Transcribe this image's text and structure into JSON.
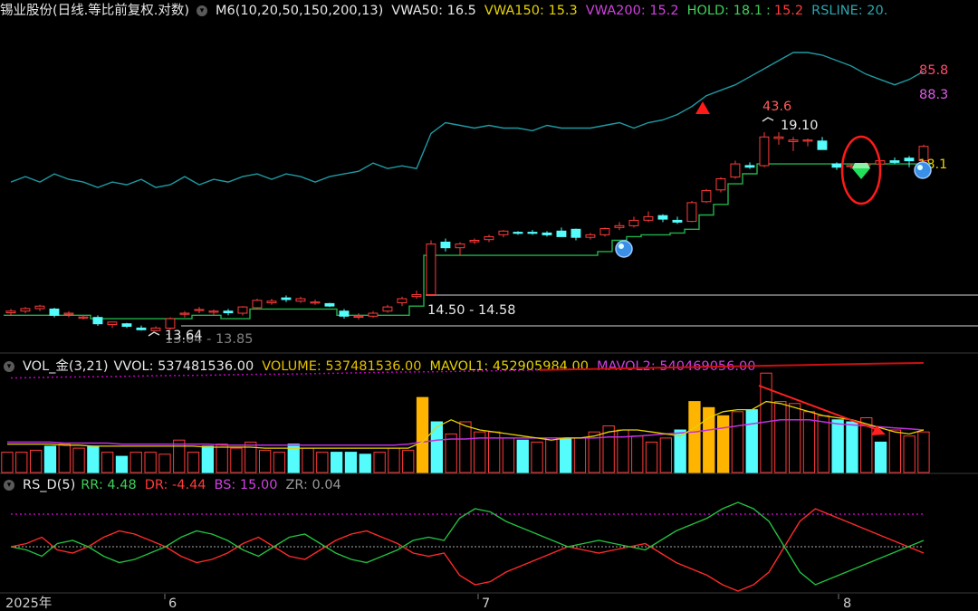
{
  "main": {
    "title": "锡业股份(日线.等比前复权.对数)",
    "indicator_name": "M6(10,20,50,150,200,13)",
    "vwa50": "VWA50: 16.5",
    "vwa150": "VWA150: 15.3",
    "vwa200": "VWA200: 15.2",
    "hold": "HOLD: 18.1",
    "hold_sep": ":",
    "hold_val2": "15.2",
    "rsline": "RSLINE: 20.",
    "label_rs_high": "85.8",
    "label_rs_now": "88.3",
    "label_peak": "43.6",
    "label_high_price": "19.10",
    "label_hold": "18.1",
    "label_range": "14.50 - 14.58",
    "label_low": "13.64",
    "label_low_range": "13.64 - 13.85"
  },
  "vol": {
    "name": "VOL_金(3,21)",
    "vvol": "VVOL: 537481536.00",
    "volume": "VOLUME: 537481536.00",
    "mavol1": "MAVOL1: 452905984.00",
    "mavol2": "MAVOL2: 540469056.00"
  },
  "rsd": {
    "name": "RS_D(5)",
    "rr": "RR: 4.48",
    "dr": "DR: -4.44",
    "bs": "BS: 15.00",
    "zr": "ZR: 0.04"
  },
  "xaxis": {
    "year": "2025年",
    "m6": "6",
    "m7": "7",
    "m8": "8"
  },
  "colors": {
    "up": "#ff3b3b",
    "down": "#54fcfc",
    "hold_line": "#21b14a",
    "rsline": "#1f9aa3",
    "vwa_purple": "#c000c0",
    "vwa_red": "#cc1010",
    "vol_gold": "#ffb400",
    "mavol1": "#e6d200",
    "mavol2": "#c030e0"
  },
  "chart_data": [
    {
      "type": "candlestick",
      "title": "锡业股份(日线.等比前复权.对数)",
      "scale": "log",
      "candles": [
        {
          "o": 14.06,
          "h": 14.15,
          "l": 14.0,
          "c": 14.1
        },
        {
          "o": 14.1,
          "h": 14.2,
          "l": 14.05,
          "c": 14.16
        },
        {
          "o": 14.16,
          "h": 14.25,
          "l": 14.1,
          "c": 14.22
        },
        {
          "o": 14.15,
          "h": 14.18,
          "l": 13.95,
          "c": 14.0
        },
        {
          "o": 14.05,
          "h": 14.1,
          "l": 13.95,
          "c": 14.05
        },
        {
          "o": 13.96,
          "h": 14.0,
          "l": 13.9,
          "c": 13.96
        },
        {
          "o": 13.95,
          "h": 14.0,
          "l": 13.75,
          "c": 13.8
        },
        {
          "o": 13.78,
          "h": 13.85,
          "l": 13.7,
          "c": 13.84
        },
        {
          "o": 13.8,
          "h": 13.82,
          "l": 13.7,
          "c": 13.74
        },
        {
          "o": 13.7,
          "h": 13.76,
          "l": 13.64,
          "c": 13.66
        },
        {
          "o": 13.64,
          "h": 13.74,
          "l": 13.62,
          "c": 13.7
        },
        {
          "o": 13.7,
          "h": 13.95,
          "l": 13.66,
          "c": 13.92
        },
        {
          "o": 14.05,
          "h": 14.1,
          "l": 13.95,
          "c": 14.05
        },
        {
          "o": 14.12,
          "h": 14.2,
          "l": 14.05,
          "c": 14.14
        },
        {
          "o": 14.1,
          "h": 14.14,
          "l": 14.0,
          "c": 14.1
        },
        {
          "o": 14.1,
          "h": 14.15,
          "l": 14.0,
          "c": 14.06
        },
        {
          "o": 14.05,
          "h": 14.22,
          "l": 14.0,
          "c": 14.2
        },
        {
          "o": 14.18,
          "h": 14.4,
          "l": 14.15,
          "c": 14.36
        },
        {
          "o": 14.3,
          "h": 14.4,
          "l": 14.25,
          "c": 14.34
        },
        {
          "o": 14.42,
          "h": 14.48,
          "l": 14.32,
          "c": 14.38
        },
        {
          "o": 14.34,
          "h": 14.45,
          "l": 14.3,
          "c": 14.4
        },
        {
          "o": 14.32,
          "h": 14.38,
          "l": 14.25,
          "c": 14.32
        },
        {
          "o": 14.28,
          "h": 14.3,
          "l": 14.2,
          "c": 14.22
        },
        {
          "o": 14.1,
          "h": 14.15,
          "l": 13.92,
          "c": 13.98
        },
        {
          "o": 13.98,
          "h": 14.05,
          "l": 13.9,
          "c": 13.98
        },
        {
          "o": 13.98,
          "h": 14.1,
          "l": 13.94,
          "c": 14.05
        },
        {
          "o": 14.1,
          "h": 14.25,
          "l": 14.06,
          "c": 14.2
        },
        {
          "o": 14.3,
          "h": 14.45,
          "l": 14.22,
          "c": 14.4
        },
        {
          "o": 14.45,
          "h": 14.6,
          "l": 14.4,
          "c": 14.5
        },
        {
          "o": 14.5,
          "h": 15.9,
          "l": 14.5,
          "c": 15.8
        },
        {
          "o": 15.85,
          "h": 15.95,
          "l": 15.6,
          "c": 15.7
        },
        {
          "o": 15.7,
          "h": 15.85,
          "l": 15.5,
          "c": 15.8
        },
        {
          "o": 15.86,
          "h": 15.95,
          "l": 15.8,
          "c": 15.9
        },
        {
          "o": 15.92,
          "h": 16.05,
          "l": 15.85,
          "c": 16.0
        },
        {
          "o": 16.05,
          "h": 16.18,
          "l": 15.98,
          "c": 16.15
        },
        {
          "o": 16.12,
          "h": 16.15,
          "l": 16.05,
          "c": 16.1
        },
        {
          "o": 16.12,
          "h": 16.18,
          "l": 16.05,
          "c": 16.1
        },
        {
          "o": 16.1,
          "h": 16.15,
          "l": 16.0,
          "c": 16.05
        },
        {
          "o": 16.15,
          "h": 16.25,
          "l": 16.0,
          "c": 16.0
        },
        {
          "o": 16.2,
          "h": 16.22,
          "l": 15.9,
          "c": 15.98
        },
        {
          "o": 15.98,
          "h": 16.1,
          "l": 15.92,
          "c": 16.05
        },
        {
          "o": 16.05,
          "h": 16.25,
          "l": 16.0,
          "c": 16.22
        },
        {
          "o": 16.25,
          "h": 16.4,
          "l": 16.18,
          "c": 16.3
        },
        {
          "o": 16.3,
          "h": 16.55,
          "l": 16.25,
          "c": 16.45
        },
        {
          "o": 16.45,
          "h": 16.7,
          "l": 16.4,
          "c": 16.55
        },
        {
          "o": 16.58,
          "h": 16.62,
          "l": 16.4,
          "c": 16.48
        },
        {
          "o": 16.45,
          "h": 16.55,
          "l": 16.35,
          "c": 16.4
        },
        {
          "o": 16.42,
          "h": 17.0,
          "l": 16.4,
          "c": 16.95
        },
        {
          "o": 16.98,
          "h": 17.35,
          "l": 16.95,
          "c": 17.3
        },
        {
          "o": 17.32,
          "h": 17.7,
          "l": 17.25,
          "c": 17.65
        },
        {
          "o": 17.7,
          "h": 18.2,
          "l": 17.65,
          "c": 18.1
        },
        {
          "o": 18.05,
          "h": 18.15,
          "l": 17.95,
          "c": 18.0
        },
        {
          "o": 18.05,
          "h": 19.1,
          "l": 18.0,
          "c": 18.95
        },
        {
          "o": 18.9,
          "h": 19.1,
          "l": 18.7,
          "c": 18.95
        },
        {
          "o": 18.8,
          "h": 18.95,
          "l": 18.5,
          "c": 18.85
        },
        {
          "o": 18.82,
          "h": 18.9,
          "l": 18.65,
          "c": 18.85
        },
        {
          "o": 18.82,
          "h": 18.95,
          "l": 18.6,
          "c": 18.55
        },
        {
          "o": 18.1,
          "h": 18.15,
          "l": 17.92,
          "c": 18.0
        },
        {
          "o": 18.05,
          "h": 18.1,
          "l": 17.95,
          "c": 18.05
        },
        {
          "o": 18.05,
          "h": 18.15,
          "l": 17.98,
          "c": 18.1
        },
        {
          "o": 18.1,
          "h": 18.2,
          "l": 18.0,
          "c": 18.2
        },
        {
          "o": 18.2,
          "h": 18.3,
          "l": 18.1,
          "c": 18.15
        },
        {
          "o": 18.28,
          "h": 18.35,
          "l": 18.0,
          "c": 18.2
        },
        {
          "o": 18.2,
          "h": 18.7,
          "l": 18.15,
          "c": 18.65
        }
      ],
      "hold_line": [
        14.0,
        14.0,
        14.0,
        14.0,
        14.0,
        14.0,
        13.92,
        13.92,
        13.92,
        13.92,
        13.92,
        13.92,
        13.92,
        14.0,
        14.0,
        13.92,
        13.92,
        14.15,
        14.15,
        14.15,
        14.15,
        14.15,
        14.15,
        14.0,
        14.0,
        14.0,
        14.0,
        14.0,
        14.22,
        15.5,
        15.5,
        15.5,
        15.5,
        15.5,
        15.5,
        15.5,
        15.5,
        15.5,
        15.5,
        15.5,
        15.5,
        15.6,
        15.9,
        16.0,
        16.05,
        16.05,
        16.1,
        16.2,
        16.6,
        16.9,
        17.5,
        17.8,
        18.1,
        18.1,
        18.1,
        18.1,
        18.1,
        18.1,
        18.1,
        18.1,
        18.1,
        18.1,
        18.1,
        18.1
      ],
      "rsline": [
        82.0,
        82.2,
        82.0,
        82.3,
        82.1,
        82.0,
        81.8,
        82.0,
        81.9,
        82.1,
        81.8,
        81.9,
        82.2,
        81.9,
        82.1,
        82.0,
        82.2,
        82.3,
        82.1,
        82.3,
        82.2,
        82.0,
        82.2,
        82.3,
        82.4,
        82.7,
        82.5,
        82.6,
        82.5,
        83.8,
        84.2,
        84.1,
        84.0,
        84.1,
        84.0,
        84.0,
        83.9,
        84.1,
        84.0,
        84.0,
        84.0,
        84.1,
        84.2,
        84.0,
        84.2,
        84.3,
        84.5,
        84.8,
        85.2,
        85.4,
        85.6,
        85.9,
        86.2,
        86.5,
        86.8,
        86.8,
        86.7,
        86.5,
        86.3,
        86.0,
        85.8,
        85.6,
        85.8,
        86.1
      ],
      "vwa_dotted": [
        13.08,
        13.1,
        13.11,
        13.13,
        13.14,
        13.16,
        13.17,
        13.19,
        13.21,
        13.22,
        13.24,
        13.26,
        13.28,
        13.3,
        13.32,
        13.34,
        13.36,
        13.38,
        13.4,
        13.42
      ],
      "vwa150": 15.3,
      "vwa200": 15.2,
      "annotations": [
        "43.6",
        "19.10",
        "18.1",
        "14.50 - 14.58",
        "13.64",
        "13.64 - 13.85",
        "85.8",
        "88.3"
      ]
    },
    {
      "type": "bar",
      "title": "VOL_金(3,21)",
      "values": [
        20,
        20,
        22,
        26,
        28,
        24,
        26,
        20,
        16,
        20,
        20,
        18,
        32,
        20,
        26,
        28,
        24,
        30,
        22,
        20,
        28,
        24,
        20,
        20,
        20,
        18,
        20,
        24,
        22,
        74,
        50,
        38,
        50,
        40,
        40,
        34,
        32,
        30,
        34,
        34,
        34,
        40,
        46,
        42,
        36,
        30,
        34,
        42,
        70,
        64,
        56,
        60,
        62,
        98,
        70,
        68,
        60,
        56,
        52,
        50,
        54,
        30,
        42,
        36,
        40
      ],
      "colors": [
        "up",
        "up",
        "up",
        "down",
        "up",
        "up",
        "down",
        "up",
        "down",
        "up",
        "up",
        "up",
        "up",
        "up",
        "down",
        "up",
        "up",
        "up",
        "up",
        "up",
        "down",
        "up",
        "up",
        "down",
        "down",
        "down",
        "up",
        "up",
        "up",
        "gold",
        "down",
        "up",
        "up",
        "up",
        "up",
        "up",
        "down",
        "up",
        "up",
        "down",
        "up",
        "up",
        "up",
        "up",
        "up",
        "up",
        "up",
        "down",
        "gold",
        "gold",
        "gold",
        "up",
        "down",
        "up",
        "up",
        "up",
        "up",
        "up",
        "down",
        "down",
        "up",
        "down",
        "up",
        "up",
        "up"
      ],
      "mavol1": [
        28,
        28,
        28,
        28,
        27,
        27,
        26,
        26,
        26,
        26,
        26,
        26,
        26,
        26,
        25,
        25,
        25,
        25,
        24,
        24,
        24,
        24,
        24,
        24,
        24,
        24,
        24,
        24,
        24,
        30,
        45,
        52,
        46,
        42,
        40,
        38,
        36,
        34,
        32,
        34,
        34,
        36,
        40,
        42,
        42,
        40,
        38,
        36,
        44,
        54,
        60,
        62,
        62,
        70,
        68,
        64,
        60,
        56,
        54,
        52,
        48,
        44,
        40,
        38,
        42
      ],
      "mavol2": [
        30,
        30,
        30,
        30,
        29,
        29,
        29,
        29,
        28,
        28,
        28,
        28,
        28,
        28,
        28,
        27,
        27,
        27,
        27,
        27,
        27,
        27,
        27,
        27,
        27,
        27,
        27,
        27,
        28,
        30,
        32,
        33,
        33,
        34,
        34,
        34,
        34,
        34,
        34,
        34,
        34,
        34,
        35,
        35,
        36,
        37,
        38,
        39,
        40,
        42,
        44,
        46,
        48,
        50,
        52,
        52,
        52,
        50,
        48,
        47,
        46,
        45,
        44,
        43,
        42
      ]
    },
    {
      "type": "line",
      "title": "RS_D(5)",
      "series": [
        {
          "name": "RR",
          "values": [
            0,
            -1,
            -3,
            1,
            2,
            0,
            -3,
            -5,
            -4,
            -2,
            0,
            3,
            5,
            4,
            2,
            -1,
            -3,
            0,
            3,
            4,
            1,
            -2,
            -4,
            -5,
            -3,
            -1,
            2,
            3,
            2,
            9,
            12,
            11,
            8,
            6,
            4,
            2,
            0,
            1,
            2,
            1,
            0,
            -1,
            2,
            5,
            7,
            9,
            12,
            14,
            12,
            8,
            0,
            -8,
            -12,
            -10,
            -8,
            -6,
            -4,
            -2,
            0,
            2
          ]
        },
        {
          "name": "DR",
          "values": [
            0,
            1,
            3,
            -1,
            -2,
            0,
            3,
            5,
            4,
            2,
            0,
            -3,
            -5,
            -4,
            -2,
            1,
            3,
            0,
            -3,
            -4,
            -1,
            2,
            4,
            5,
            3,
            1,
            -2,
            -3,
            -2,
            -9,
            -12,
            -11,
            -8,
            -6,
            -4,
            -2,
            0,
            -1,
            -2,
            -1,
            0,
            1,
            -2,
            -5,
            -7,
            -9,
            -12,
            -14,
            -12,
            -8,
            0,
            8,
            12,
            10,
            8,
            6,
            4,
            2,
            0,
            -2
          ]
        },
        {
          "name": "BS",
          "values": [
            15,
            15,
            15,
            15,
            15,
            15,
            15,
            15,
            15,
            15,
            15,
            15,
            15,
            15,
            15,
            15,
            15,
            15,
            15,
            15,
            15,
            15,
            15,
            15,
            15,
            15,
            15,
            15,
            15,
            15,
            15,
            15,
            15,
            15,
            15,
            15,
            15,
            15,
            15,
            15,
            15,
            15,
            15,
            15,
            15,
            15,
            15,
            15,
            15,
            15,
            15,
            15,
            15,
            15,
            15,
            15,
            15,
            15,
            15,
            15
          ]
        },
        {
          "name": "ZR",
          "values": [
            0,
            0,
            0,
            0,
            0,
            0,
            0,
            0,
            0,
            0,
            0,
            0,
            0,
            0,
            0,
            0,
            0,
            0,
            0,
            0,
            0,
            0,
            0,
            0,
            0,
            0,
            0,
            0,
            0,
            0,
            0,
            0,
            0,
            0,
            0,
            0,
            0,
            0,
            0,
            0,
            0,
            0,
            0,
            0,
            0,
            0,
            0,
            0,
            0,
            0,
            0,
            0,
            0,
            0,
            0,
            0,
            0,
            0,
            0,
            0
          ]
        }
      ]
    }
  ]
}
